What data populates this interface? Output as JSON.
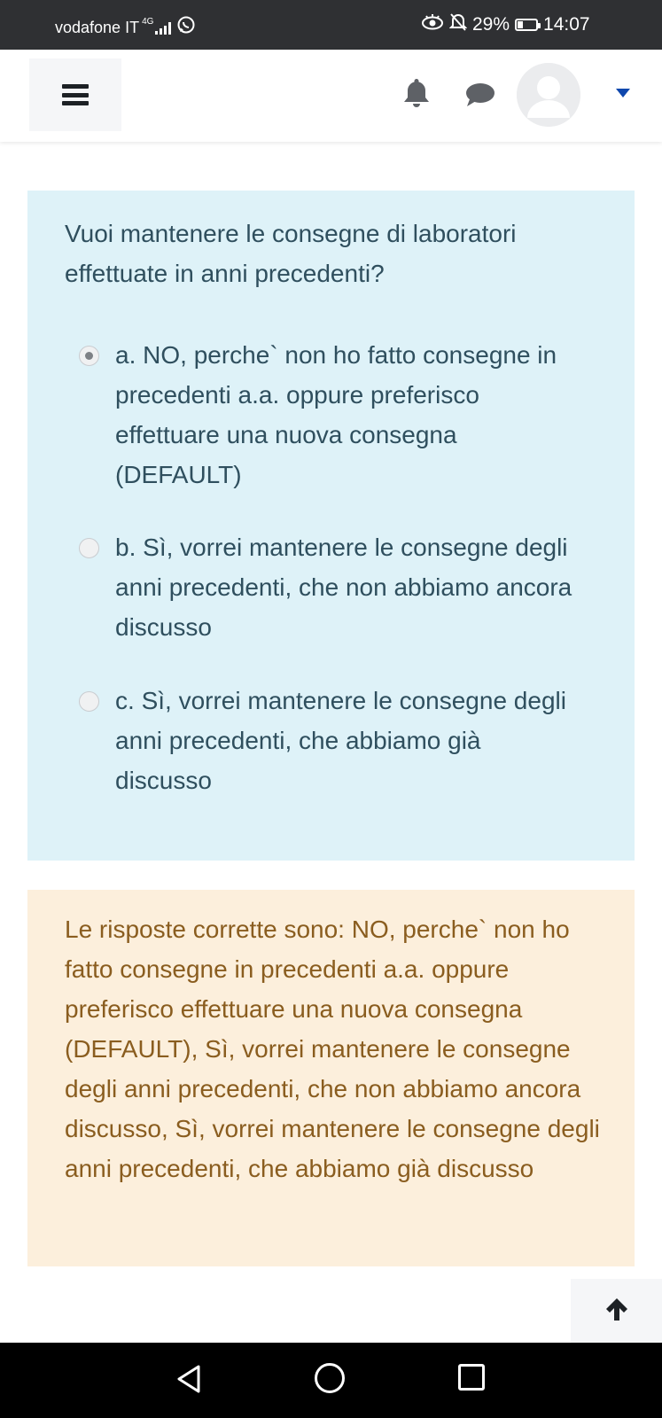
{
  "status_bar": {
    "carrier": "vodafone IT",
    "network": "4G",
    "battery": "29%",
    "time": "14:07",
    "battery_level": 0.29
  },
  "header": {
    "menu_icon": "hamburger-icon",
    "notifications_icon": "bell-icon",
    "messages_icon": "chat-bubble-icon",
    "user_icon": "avatar-icon",
    "user_menu_icon": "caret-down-icon",
    "accent_color": "#0f47ad"
  },
  "question": {
    "text": "Vuoi mantenere le consegne di laboratori effettuate in anni precedenti?",
    "options": [
      {
        "letter": "a.",
        "text": "NO,  perche` non ho fatto consegne in precedenti a.a. oppure preferisco effettuare una nuova consegna (DEFAULT)",
        "checked": true
      },
      {
        "letter": "b.",
        "text": "Sì, vorrei mantenere le consegne degli anni precedenti, che non abbiamo ancora discusso",
        "checked": false
      },
      {
        "letter": "c.",
        "text": "Sì, vorrei mantenere le consegne degli anni precedenti, che abbiamo già discusso",
        "checked": false
      }
    ],
    "background_color": "#def2f8"
  },
  "feedback": {
    "text": "Le risposte corrette sono: NO,  perche` non ho fatto consegne in precedenti a.a. oppure preferisco effettuare una nuova consegna (DEFAULT), Sì, vorrei mantenere le consegne degli anni precedenti, che non abbiamo ancora discusso, Sì, vorrei mantenere le consegne degli anni precedenti, che abbiamo già discusso",
    "background_color": "#fcefdc"
  },
  "back_to_top_icon": "arrow-up-icon",
  "nav_bar": {
    "back_icon": "back-triangle-icon",
    "home_icon": "home-circle-icon",
    "recents_icon": "recents-square-icon"
  }
}
